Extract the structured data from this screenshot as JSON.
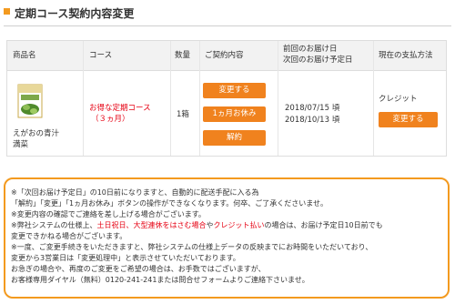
{
  "header": {
    "title": "定期コース契約内容変更"
  },
  "table": {
    "columns": [
      "商品名",
      "コース",
      "数量",
      "ご契約内容",
      "前回のお届け日",
      "次回のお届け予定日",
      "現在の支払方法"
    ],
    "row": {
      "product_name_1": "えがおの青汁",
      "product_name_2": "満菜",
      "course_1": "お得な定期コース",
      "course_2": "（３ヵ月）",
      "quantity": "1箱",
      "buttons": {
        "change": "変更する",
        "skip": "1ヵ月お休み",
        "cancel": "解約"
      },
      "last_delivery": "2018/07/15 頃",
      "next_delivery": "2018/10/13 頃",
      "payment_method": "クレジット",
      "payment_change": "変更する"
    }
  },
  "notice": {
    "line1": "※「次回お届け予定日」の10日前になりますと、自動的に配送手配に入る為",
    "line2": "「解約」「変更」「1ヵ月お休み」ボタンの操作ができなくなります。何卒、ご了承くださいませ。",
    "line3": "※変更内容の確認でご連絡を差し上げる場合がございます。",
    "line4_a": "※弊社システムの仕様上、",
    "line4_b": "土日祝日、大型連休をはさむ場合",
    "line4_c": "や",
    "line4_d": "クレジット払い",
    "line4_e": "の場合は、お届け予定日10日前でも",
    "line5": "変更できかねる場合がございます。",
    "line6": "※一度、ご変更手続きをいただきますと、弊社システムの仕様上データの反映までにお時間をいただいており、",
    "line7": "変更から3営業日は「変更処理中」と表示させていただいております。",
    "line8": "お急ぎの場合や、再度のご変更をご希望の場合は、お手数ではございますが、",
    "line9": "お客様専用ダイヤル（無料）0120-241-241または問合せフォームよりご連絡下さいませ。"
  },
  "colors": {
    "accent": "#f0821e",
    "border": "#f39a1f",
    "red": "#e60012"
  }
}
